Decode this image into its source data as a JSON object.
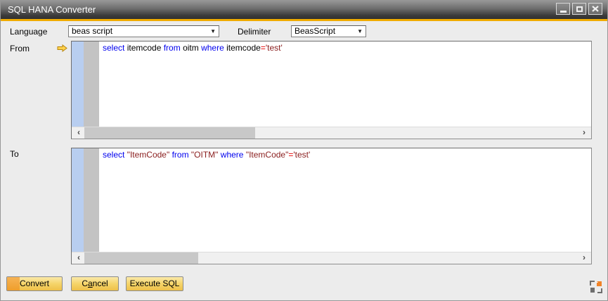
{
  "window": {
    "title": "SQL HANA Converter"
  },
  "form": {
    "language_label": "Language",
    "language_value": "beas script",
    "delimiter_label": "Delimiter",
    "delimiter_value": "BeasScript"
  },
  "from_section": {
    "label": "From",
    "tokens": [
      {
        "text": "select ",
        "color": "keyword"
      },
      {
        "text": "itemcode ",
        "color": "plain"
      },
      {
        "text": "from ",
        "color": "keyword"
      },
      {
        "text": "oitm ",
        "color": "plain"
      },
      {
        "text": "where ",
        "color": "keyword"
      },
      {
        "text": "itemcode",
        "color": "plain"
      },
      {
        "text": "=",
        "color": "operator"
      },
      {
        "text": "'test'",
        "color": "string"
      }
    ]
  },
  "to_section": {
    "label": "To",
    "tokens": [
      {
        "text": "select ",
        "color": "keyword"
      },
      {
        "text": "\"ItemCode\" ",
        "color": "string"
      },
      {
        "text": "from ",
        "color": "keyword"
      },
      {
        "text": "\"OITM\" ",
        "color": "string"
      },
      {
        "text": "where ",
        "color": "keyword"
      },
      {
        "text": "\"ItemCode\"",
        "color": "string"
      },
      {
        "text": "=",
        "color": "operator"
      },
      {
        "text": "'test'",
        "color": "string"
      }
    ]
  },
  "buttons": {
    "convert": "Convert",
    "cancel_pre": "C",
    "cancel_key": "a",
    "cancel_post": "ncel",
    "execute": "Execute SQL"
  },
  "syntax_colors": {
    "keyword": "#0000EE",
    "plain": "#000000",
    "operator": "#E80000",
    "string": "#8B2020"
  },
  "colors": {
    "titlebar_accent": "#F0AB00",
    "button_gold": "#EEC049",
    "default_button_indicator": "#F0A030",
    "gutter_blue": "#B8CEF0",
    "gutter_gray": "#C3C3C3"
  },
  "icons": {
    "dropdown_arrow": "▼",
    "scroll_left": "‹",
    "scroll_right": "›"
  }
}
